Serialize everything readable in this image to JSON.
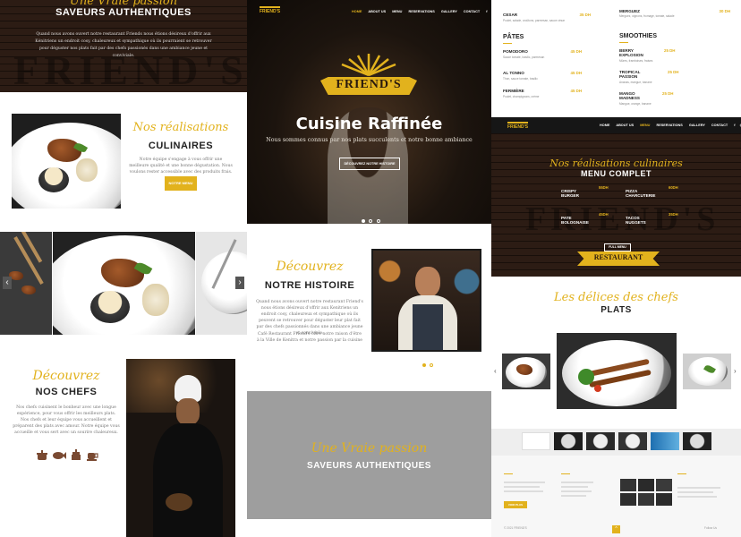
{
  "col1": {
    "top": {
      "script": "Une Vraie passion",
      "title": "SAVEURS AUTHENTIQUES",
      "text": "Quand nous avons ouvert notre restaurant Friends nous étions désireux d'offrir aux Kénitriens un endroit cosy, chaleureux et sympathique où ils pourraient se retrouver pour déguster nos plats fait par des chefs passionés dans une ambiance jeune et conviviale.",
      "bg_word": "FRIEND'S"
    },
    "realisations": {
      "script": "Nos réalisations",
      "title": "CULINAIRES",
      "text": "Notre équipe s'engage à vous offrir une meilleure qualité et une bonne dégustation. Nous voulons rester accessible avec des produits frais.",
      "button": "Notre menu"
    },
    "slider": {
      "prev": "‹",
      "next": "›"
    },
    "chefs": {
      "script": "Découvrez",
      "title": "NOS CHEFS",
      "text": "Nos chefs cuisinent le bonheur avec une longue expérience, pour vous offrir les meilleurs plats. Nos chefs et leur équipe vous accueillent et préparent des plats avec amour. Notre équipe vous accueille et vous sert avec un sourire chaleureux.",
      "icons": [
        "pot-icon",
        "fish-icon",
        "cake-icon",
        "cup-icon"
      ]
    }
  },
  "col2": {
    "nav": {
      "logo": "FRIEND'S",
      "items": [
        "HOME",
        "ABOUT US",
        "MENU",
        "RESERVATIONS",
        "GALLERY",
        "CONTACT"
      ],
      "social": [
        "f",
        "◎"
      ]
    },
    "hero": {
      "logo_text": "FRIEND'S",
      "title": "Cuisine Raffinée",
      "subtitle": "Nous sommes connus par nos plats succulents et notre bonne ambiance",
      "button": "Découvrez notre histoire"
    },
    "histoire": {
      "script": "Découvrez",
      "title": "NOTRE HISTOIRE",
      "text": "Quand nous avons ouvert notre restaurant Friend's nous étions désireux d'offrir aux Kenitriens un endroit cosy, chaleureux et sympathique où ils peuvent se retrouver pour déguster leur plat fait par des chefs passionnés dans une ambiance jeune et conviviale.",
      "text2": "Café Restaurant Friend's offre notre raison d'être à la Ville de Kenitra et notre passion par la cuisine"
    },
    "bottom": {
      "script": "Une Vraie passion",
      "title": "SAVEURS AUTHENTIQUES"
    }
  },
  "col3": {
    "menu_cols": [
      {
        "top_item": {
          "name": "CESAR",
          "price": "35 DH",
          "desc": "Poulet, salade, croûtons, parmesan, sauce césar"
        },
        "section": "PÂTES",
        "items": [
          {
            "name": "POMODORO",
            "price": "45 DH",
            "desc": "Sauce tomate, basilic, parmesan"
          },
          {
            "name": "AL TONNO",
            "price": "45 DH",
            "desc": "Thon, sauce tomate, basilic"
          },
          {
            "name": "FERMIÈRE",
            "price": "45 DH",
            "desc": "Poulet, champignons, crème"
          }
        ]
      },
      {
        "top_item": {
          "name": "MERGUEZ",
          "price": "30 DH",
          "desc": "Merguez, oignons, fromage, tomate, salade"
        },
        "section": "SMOOTHIES",
        "items": [
          {
            "name": "BERRY EXPLOSION",
            "price": "25 DH",
            "desc": "Mûres, framboises, fraises"
          },
          {
            "name": "TROPICAL PASSION",
            "price": "25 DH",
            "desc": "Ananas, mangue, banane"
          },
          {
            "name": "MANGO MADNESS",
            "price": "25 DH",
            "desc": "Mangue, orange, banane"
          }
        ]
      }
    ],
    "nav": {
      "logo": "FRIEND'S",
      "items": [
        "HOME",
        "ABOUT US",
        "MENU",
        "RESERVATIONS",
        "GALLERY",
        "CONTACT"
      ],
      "social": [
        "f",
        "◎"
      ]
    },
    "menu_complet": {
      "script": "Nos réalisations culinaires",
      "title": "MENU COMPLET",
      "items": [
        {
          "name": "CRISPY BURGER",
          "price": "55DH"
        },
        {
          "name": "PIZZA CHARCUTERIE",
          "price": "60DH"
        },
        {
          "name": "PATE BOLOGNAISE",
          "price": "45DH"
        },
        {
          "name": "TACOS NUGGETS",
          "price": "35DH"
        }
      ],
      "button": "Full Menu",
      "banner": "RESTAURANT"
    },
    "plats": {
      "script": "Les délices des chefs",
      "title": "PLATS",
      "prev": "‹",
      "next": "›"
    },
    "footer": {
      "button": "Voir plus",
      "copyright": "© 2021 FRIEND'S",
      "follow": "Follow Us"
    }
  }
}
